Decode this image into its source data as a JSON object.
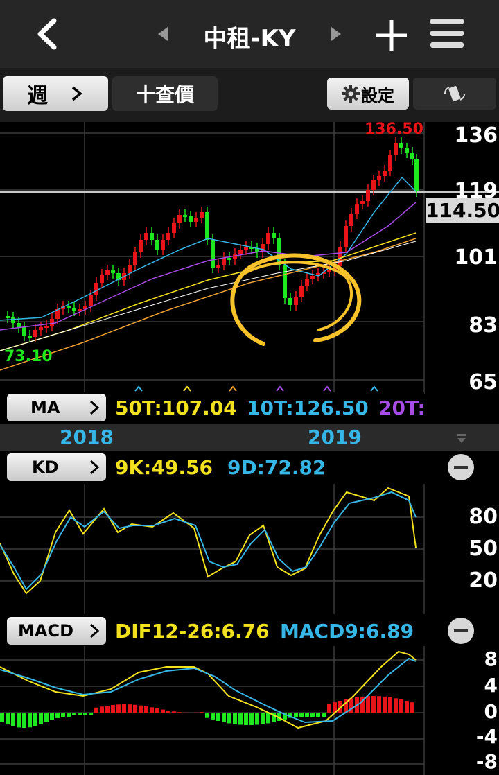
{
  "header": {
    "title": "中租-KY"
  },
  "toolbar": {
    "period_label": "週",
    "crosshair_label": "十查價",
    "settings_label": "設定"
  },
  "main_chart": {
    "y_ticks": [
      "136",
      "119",
      "101",
      "83",
      "65"
    ],
    "current_price": "114.50",
    "high_label": "136.50",
    "low_label": "73.10"
  },
  "ma_panel": {
    "button_label": "MA",
    "ma50": "50T:107.04",
    "ma10": "10T:126.50",
    "ma20": "20T:"
  },
  "time_axis": {
    "labels": [
      "2018",
      "2019"
    ]
  },
  "kd_panel": {
    "button_label": "KD",
    "k": "9K:49.56",
    "d": "9D:72.82",
    "y_ticks": [
      "80",
      "50",
      "20"
    ]
  },
  "macd_panel": {
    "button_label": "MACD",
    "dif": "DIF12-26:6.76",
    "macd": "MACD9:6.89",
    "y_ticks": [
      "8",
      "4",
      "0",
      "-4",
      "-8"
    ]
  },
  "colors": {
    "up": "#e8141a",
    "down": "#1ee81e",
    "ma_yellow": "#f2e11d",
    "ma_cyan": "#36b6e6",
    "ma_purple": "#a64be6",
    "ma_orange": "#f0a030",
    "annotation": "#f8c22a"
  }
}
